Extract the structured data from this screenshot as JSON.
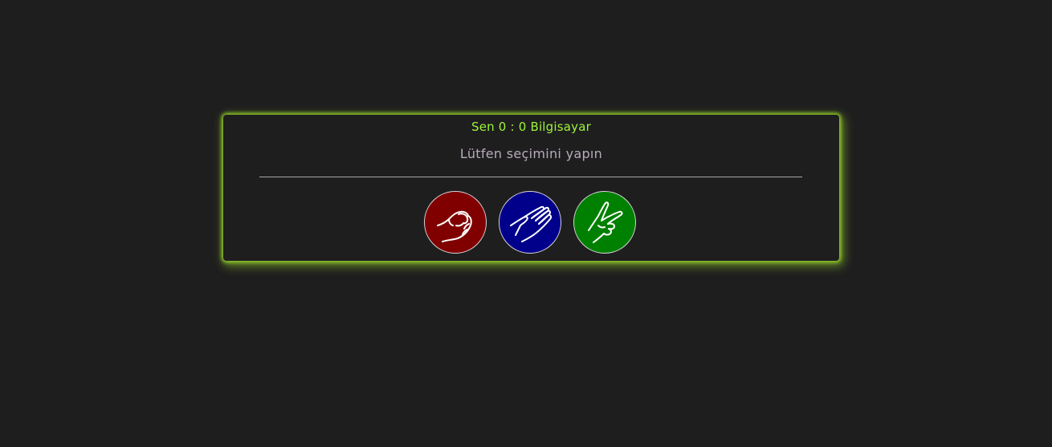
{
  "scoreboard": {
    "text": "Sen 0 : 0 Bilgisayar",
    "color": "#9cf43a"
  },
  "message": {
    "text": "Lütfen seçimini yapın",
    "color": "#b7abbb"
  },
  "choices": [
    {
      "id": "rock",
      "icon": "rock-fist-icon",
      "color": "#800000"
    },
    {
      "id": "paper",
      "icon": "paper-hand-icon",
      "color": "#00008b"
    },
    {
      "id": "scissors",
      "icon": "scissors-hand-icon",
      "color": "#008000"
    }
  ],
  "theme": {
    "background": "#1f1e1f",
    "glow": "#93d02a"
  }
}
